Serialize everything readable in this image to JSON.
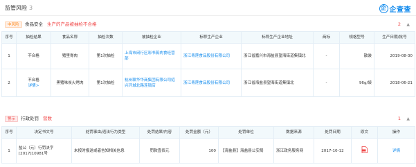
{
  "header": {
    "title": "监管风险",
    "count": "3",
    "brand_icon": "企",
    "brand_text": "企查查"
  },
  "section1": {
    "tag": "中风险",
    "title": "食品安全",
    "subtitle": "生产的产品被抽检不合格",
    "count": "2",
    "columns": [
      "序号",
      "抽检结果",
      "食品名称",
      "抽检次数",
      "被抽检企业",
      "标称生产企业",
      "标称生产企业地址",
      "商标",
      "规格型号",
      "生产日期/批号"
    ],
    "rows": [
      {
        "no": "1",
        "result": "不合格",
        "result_link": "",
        "food": "猪里脊肉",
        "times": "第1次抽检",
        "company": "上海市闵行区彩书蒸肉食经营部",
        "producer": "浙江青莲食品股份有限公司",
        "address": "浙江省嘉兴市海盐县望海街道集镇北",
        "brand": "-",
        "spec": "散装",
        "date": "2019-08-30"
      },
      {
        "no": "2",
        "result": "不合格",
        "result_link": "详情>",
        "food": "黑猪味炭火烤肉",
        "times": "第1次抽检",
        "company": "杭州联华华商集团有限公司绍兴环城北路连锁店",
        "producer": "浙江青莲食品股份有限公司",
        "address": "浙江省海盐县望海街道集镇北",
        "brand": "-",
        "spec": "96g/袋",
        "date": "2018-06-21"
      }
    ]
  },
  "section2": {
    "tag": "警示",
    "title": "行政处罚",
    "subtitle": "营数",
    "count": "1",
    "columns": [
      "序号",
      "决定书文号",
      "处罚事由/违法行为类型",
      "处罚结果/内容",
      "处罚金额（元）",
      "处罚单位",
      "数据来源",
      "处罚日期",
      "原文",
      "操作"
    ],
    "rows": [
      {
        "no": "1",
        "doc_no": "盐公（元）行罚决字[2017]10981号",
        "reason": "未按时报送或者告知相关信息",
        "result": "罚款壹佰元",
        "amount": "100",
        "unit": "【海盐县】海盐县公安局",
        "source": "浙江政务服务网",
        "date": "2017-10-12",
        "action": "详情"
      }
    ]
  },
  "colors": {
    "accent": "#128bed",
    "risk": "#f04848",
    "warning": "#ff8a1c",
    "header_bg": "#f2f9fc"
  }
}
